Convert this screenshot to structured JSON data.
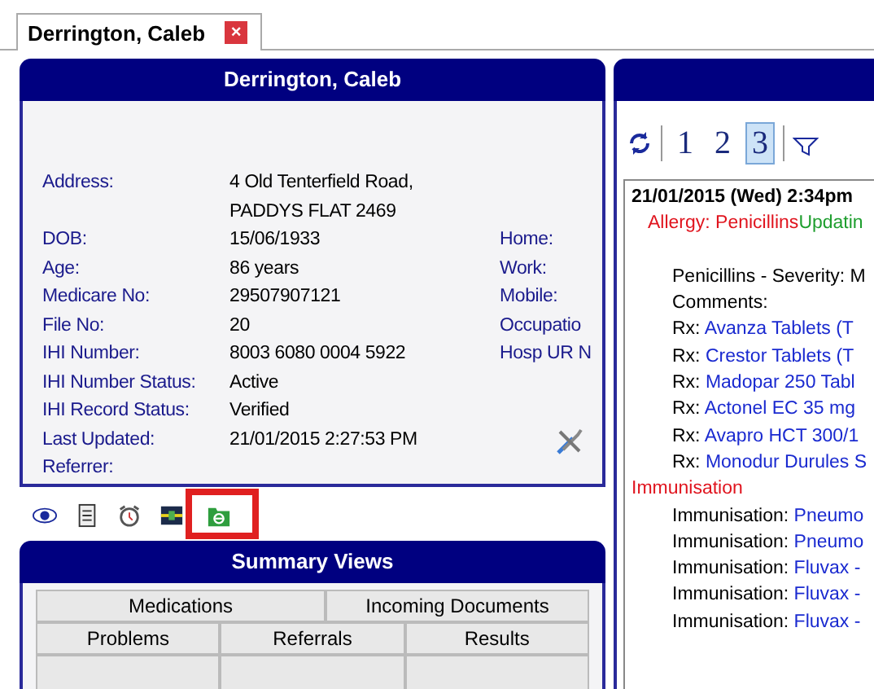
{
  "tab": {
    "label": "Derrington, Caleb",
    "close": "×"
  },
  "patient_panel": {
    "title": "Derrington, Caleb",
    "fields": [
      {
        "label": "Address:",
        "values": [
          "4 Old Tenterfield Road,",
          "PADDYS FLAT  2469"
        ]
      },
      {
        "label": "DOB:",
        "values": [
          "15/06/1933"
        ]
      },
      {
        "label": "Age:",
        "values": [
          "86 years"
        ]
      },
      {
        "label": "Medicare No:",
        "values": [
          "29507907121"
        ]
      },
      {
        "label": "File No:",
        "values": [
          "20"
        ]
      },
      {
        "label": "IHI Number:",
        "values": [
          "8003 6080 0004 5922"
        ]
      },
      {
        "label": "IHI Number Status:",
        "values": [
          "Active"
        ]
      },
      {
        "label": "IHI Record Status:",
        "values": [
          "Verified"
        ]
      },
      {
        "label": "Last Updated:",
        "values": [
          "21/01/2015 2:27:53 PM"
        ]
      },
      {
        "label": "Referrer:"
      }
    ],
    "contact_labels": [
      "Home:",
      "Work:",
      "Mobile:",
      "Occupatio",
      "Hosp UR N"
    ]
  },
  "toolbar_icons": [
    {
      "kind": "eye"
    },
    {
      "kind": "document"
    },
    {
      "kind": "alarm"
    },
    {
      "kind": "strip"
    },
    {
      "kind": "e-folder"
    }
  ],
  "summary_views": {
    "title": "Summary Views",
    "tab_rows": [
      {
        "tabs": [
          "Medications",
          "Incoming Documents"
        ]
      },
      {
        "tabs": [
          "Problems",
          "Referrals",
          "Results"
        ]
      }
    ]
  },
  "record_toolbar": {
    "pages": [
      {
        "label": "1",
        "selected": false
      },
      {
        "label": "2",
        "selected": false
      },
      {
        "label": "3",
        "selected": true
      }
    ]
  },
  "record_lines": [
    {
      "kind": "date",
      "text": "21/01/2015 (Wed) 2:34pm"
    },
    {
      "kind": "allergy",
      "text": "Allergy: Penicillins",
      "extra": "Updatin"
    },
    {
      "kind": "blank"
    },
    {
      "kind": "plain",
      "text": "Penicillins - Severity: M"
    },
    {
      "kind": "plain",
      "text": "Comments:"
    },
    {
      "kind": "rx",
      "prefix": "Rx:",
      "text": "Avanza Tablets (T"
    },
    {
      "kind": "rx",
      "prefix": "Rx:",
      "text": "Crestor Tablets (T"
    },
    {
      "kind": "rx",
      "prefix": "Rx:",
      "text": "Madopar 250 Tabl"
    },
    {
      "kind": "rx",
      "prefix": "Rx:",
      "text": "Actonel EC 35 mg"
    },
    {
      "kind": "rx",
      "prefix": "Rx:",
      "text": "Avapro HCT 300/1"
    },
    {
      "kind": "rx",
      "prefix": "Rx:",
      "text": "Monodur Durules S"
    },
    {
      "kind": "heading",
      "text": "Immunisation"
    },
    {
      "kind": "rx",
      "prefix": "Immunisation:",
      "text": "Pneumo"
    },
    {
      "kind": "rx",
      "prefix": "Immunisation:",
      "text": "Pneumo"
    },
    {
      "kind": "rx",
      "prefix": "Immunisation:",
      "text": "Fluvax -"
    },
    {
      "kind": "rx",
      "prefix": "Immunisation:",
      "text": "Fluvax -"
    },
    {
      "kind": "rx",
      "prefix": "Immunisation:",
      "text": "Fluvax -"
    }
  ]
}
